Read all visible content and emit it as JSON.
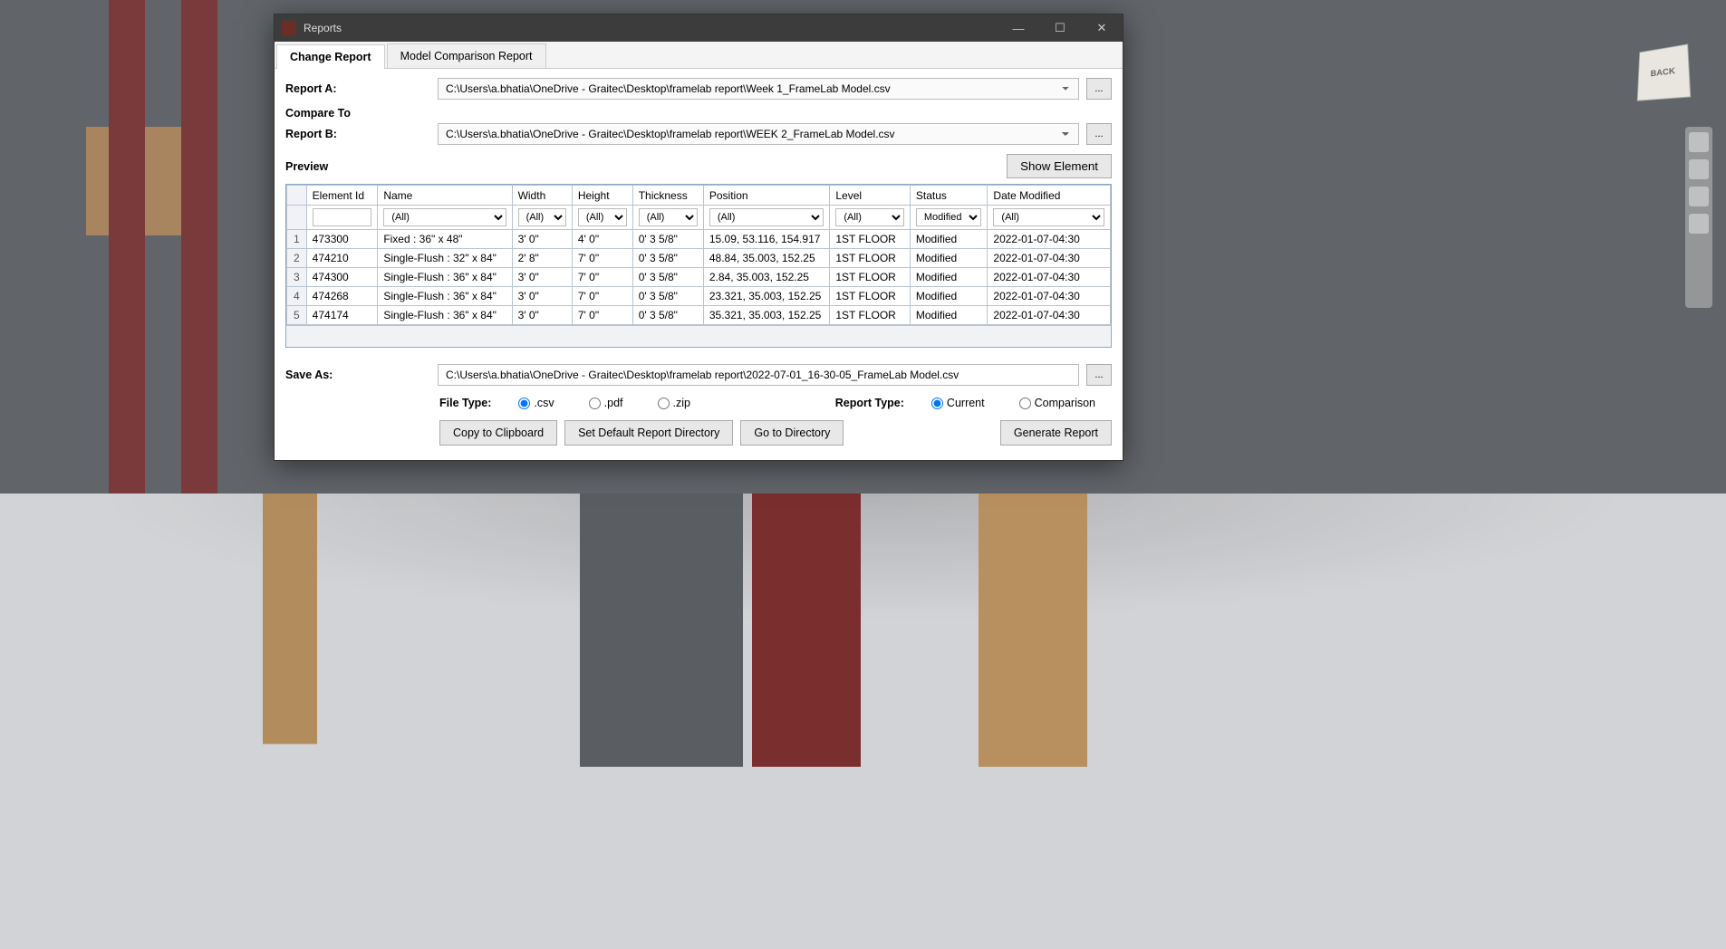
{
  "window": {
    "title": "Reports",
    "viewcube": "BACK"
  },
  "tabs": {
    "change_report": "Change Report",
    "model_comparison": "Model Comparison Report"
  },
  "labels": {
    "report_a": "Report A:",
    "compare_to": "Compare To",
    "report_b": "Report B:",
    "preview": "Preview",
    "show_element": "Show Element",
    "save_as": "Save As:",
    "file_type": "File Type:",
    "report_type": "Report Type:",
    "copy_clipboard": "Copy to Clipboard",
    "set_default_dir": "Set Default Report Directory",
    "go_to_dir": "Go to Directory",
    "generate": "Generate Report",
    "browse": "..."
  },
  "paths": {
    "report_a": "C:\\Users\\a.bhatia\\OneDrive - Graitec\\Desktop\\framelab report\\Week 1_FrameLab Model.csv",
    "report_b": "C:\\Users\\a.bhatia\\OneDrive - Graitec\\Desktop\\framelab report\\WEEK 2_FrameLab Model.csv",
    "save_as": "C:\\Users\\a.bhatia\\OneDrive - Graitec\\Desktop\\framelab report\\2022-07-01_16-30-05_FrameLab Model.csv"
  },
  "file_types": {
    "csv": ".csv",
    "pdf": ".pdf",
    "zip": ".zip"
  },
  "report_types": {
    "current": "Current",
    "comparison": "Comparison"
  },
  "grid": {
    "headers": {
      "element_id": "Element Id",
      "name": "Name",
      "width": "Width",
      "height": "Height",
      "thickness": "Thickness",
      "position": "Position",
      "level": "Level",
      "status": "Status",
      "date_modified": "Date Modified"
    },
    "filters": {
      "all": "(All)",
      "modified": "Modified"
    },
    "rows": [
      {
        "n": "1",
        "id": "473300",
        "name": "Fixed : 36\" x 48\"",
        "w": "3'  0\"",
        "h": "4'  0\"",
        "t": "0'  3 5/8\"",
        "pos": "15.09, 53.116, 154.917",
        "level": "1ST FLOOR",
        "status": "Modified",
        "date": "2022-01-07-04:30"
      },
      {
        "n": "2",
        "id": "474210",
        "name": "Single-Flush : 32\" x 84\"",
        "w": "2'  8\"",
        "h": "7'  0\"",
        "t": "0'  3 5/8\"",
        "pos": "48.84, 35.003, 152.25",
        "level": "1ST FLOOR",
        "status": "Modified",
        "date": "2022-01-07-04:30"
      },
      {
        "n": "3",
        "id": "474300",
        "name": "Single-Flush : 36\" x 84\"",
        "w": "3'  0\"",
        "h": "7'  0\"",
        "t": "0'  3 5/8\"",
        "pos": "2.84, 35.003, 152.25",
        "level": "1ST FLOOR",
        "status": "Modified",
        "date": "2022-01-07-04:30"
      },
      {
        "n": "4",
        "id": "474268",
        "name": "Single-Flush : 36\" x 84\"",
        "w": "3'  0\"",
        "h": "7'  0\"",
        "t": "0'  3 5/8\"",
        "pos": "23.321, 35.003, 152.25",
        "level": "1ST FLOOR",
        "status": "Modified",
        "date": "2022-01-07-04:30"
      },
      {
        "n": "5",
        "id": "474174",
        "name": "Single-Flush : 36\" x 84\"",
        "w": "3'  0\"",
        "h": "7'  0\"",
        "t": "0'  3 5/8\"",
        "pos": "35.321, 35.003, 152.25",
        "level": "1ST FLOOR",
        "status": "Modified",
        "date": "2022-01-07-04:30"
      }
    ]
  }
}
